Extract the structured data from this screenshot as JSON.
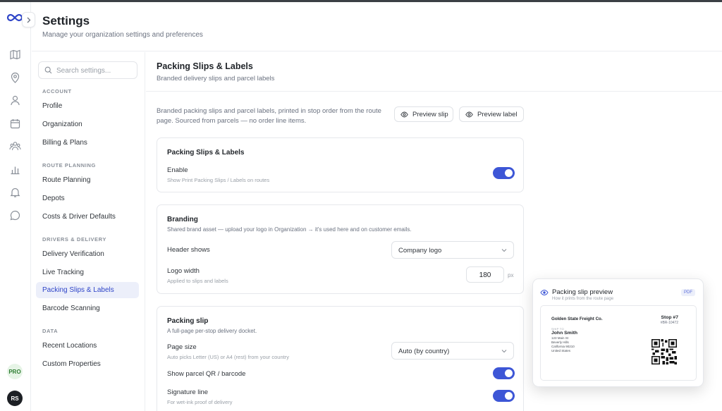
{
  "app": {
    "logo": "infinity-logo",
    "collapse_icon": "chevron-right-icon"
  },
  "rail": {
    "icons": [
      "map-icon",
      "location-pin-icon",
      "user-icon",
      "calendar-icon",
      "team-icon",
      "bar-chart-icon",
      "bell-icon",
      "chat-bubble-icon"
    ],
    "pro_badge": "PRO",
    "avatar_initials": "RS"
  },
  "header": {
    "title": "Settings",
    "subtitle": "Manage your organization settings and preferences"
  },
  "nav": {
    "search_placeholder": "Search settings...",
    "sections": [
      {
        "title": "ACCOUNT",
        "items": [
          "Profile",
          "Organization",
          "Billing & Plans"
        ]
      },
      {
        "title": "ROUTE PLANNING",
        "items": [
          "Route Planning",
          "Depots",
          "Costs & Driver Defaults"
        ]
      },
      {
        "title": "DRIVERS & DELIVERY",
        "items": [
          "Delivery Verification",
          "Live Tracking",
          "Packing Slips & Labels",
          "Barcode Scanning"
        ]
      },
      {
        "title": "DATA",
        "items": [
          "Recent Locations",
          "Custom Properties"
        ]
      }
    ],
    "active_item": "Packing Slips & Labels"
  },
  "main": {
    "title": "Packing Slips & Labels",
    "subtitle": "Branded delivery slips and parcel labels",
    "intro": "Branded packing slips and parcel labels, printed in stop order from the route page. Sourced from parcels — no order line items.",
    "preview_slip_label": "Preview slip",
    "preview_label_label": "Preview label",
    "card_enable": {
      "title": "Packing Slips & Labels",
      "enable_label": "Enable",
      "enable_hint": "Show Print Packing Slips / Labels on routes",
      "enabled": true
    },
    "card_branding": {
      "title": "Branding",
      "subtitle": "Shared brand asset — upload your logo in Organization → it's used here and on customer emails.",
      "header_shows_label": "Header shows",
      "header_shows_value": "Company logo",
      "logo_width_label": "Logo width",
      "logo_width_hint": "Applied to slips and labels",
      "logo_width_value": "180",
      "logo_width_unit": "px"
    },
    "card_slip": {
      "title": "Packing slip",
      "subtitle": "A full-page per-stop delivery docket.",
      "page_size_label": "Page size",
      "page_size_hint": "Auto picks Letter (US) or A4 (rest) from your country",
      "page_size_value": "Auto (by country)",
      "qr_label": "Show parcel QR / barcode",
      "qr_enabled": true,
      "signature_label": "Signature line",
      "signature_hint": "For wet-ink proof of delivery",
      "signature_enabled": true
    }
  },
  "preview": {
    "title": "Packing slip preview",
    "subtitle": "How it prints from the route page",
    "badge": "PDF",
    "company": "Golden State Freight Co.",
    "stop": "Stop #7",
    "ref": "#BR-10472",
    "ship_to_label": "SHIP TO",
    "name": "John Smith",
    "address": [
      "123 Main St",
      "Beverly Hills",
      "California 90210",
      "United States"
    ]
  },
  "colors": {
    "accent": "#3d56d6",
    "active_bg": "#eceffa",
    "pro_green": "#2e7d32"
  }
}
